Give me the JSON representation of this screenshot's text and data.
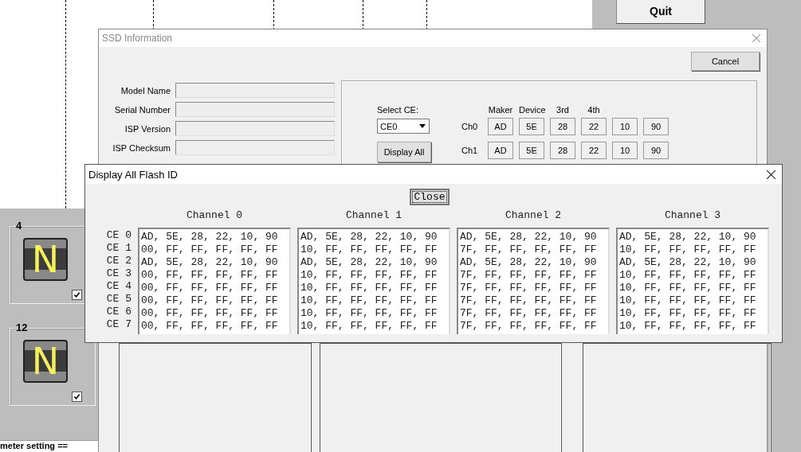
{
  "desktop": {
    "quit_button": "Quit",
    "slots": [
      {
        "label": "4",
        "icon_text": "N",
        "checked": true
      },
      {
        "label": "12",
        "icon_text": "N",
        "checked": true
      }
    ],
    "status_text": "meter setting =="
  },
  "ssd_window": {
    "title": "SSD Information",
    "cancel_button": "Cancel",
    "fields": [
      {
        "label": "Model Name"
      },
      {
        "label": "Serial Number"
      },
      {
        "label": "ISP Version"
      },
      {
        "label": "ISP Checksum"
      }
    ],
    "select_ce_label": "Select CE:",
    "ce_dropdown": "CE0",
    "display_all_button": "Display All",
    "id_headers": [
      "Maker",
      "Device",
      "3rd",
      "4th"
    ],
    "id_rows": [
      {
        "channel": "Ch0",
        "values": [
          "AD",
          "5E",
          "28",
          "22",
          "10",
          "90"
        ]
      },
      {
        "channel": "Ch1",
        "values": [
          "AD",
          "5E",
          "28",
          "22",
          "10",
          "90"
        ]
      }
    ]
  },
  "flash_window": {
    "title": "Display All Flash ID",
    "close_button": "Close",
    "ce_labels": [
      "CE 0",
      "CE 1",
      "CE 2",
      "CE 3",
      "CE 4",
      "CE 5",
      "CE 6",
      "CE 7"
    ],
    "channels": [
      {
        "title": "Channel 0",
        "lines": [
          "AD, 5E, 28, 22, 10, 90",
          "00, FF, FF, FF, FF, FF",
          "AD, 5E, 28, 22, 10, 90",
          "00, FF, FF, FF, FF, FF",
          "00, FF, FF, FF, FF, FF",
          "00, FF, FF, FF, FF, FF",
          "00, FF, FF, FF, FF, FF",
          "00, FF, FF, FF, FF, FF"
        ]
      },
      {
        "title": "Channel 1",
        "lines": [
          "AD, 5E, 28, 22, 10, 90",
          "10, FF, FF, FF, FF, FF",
          "AD, 5E, 28, 22, 10, 90",
          "10, FF, FF, FF, FF, FF",
          "10, FF, FF, FF, FF, FF",
          "10, FF, FF, FF, FF, FF",
          "10, FF, FF, FF, FF, FF",
          "10, FF, FF, FF, FF, FF"
        ]
      },
      {
        "title": "Channel 2",
        "lines": [
          "AD, 5E, 28, 22, 10, 90",
          "7F, FF, FF, FF, FF, FF",
          "AD, 5E, 28, 22, 10, 90",
          "7F, FF, FF, FF, FF, FF",
          "7F, FF, FF, FF, FF, FF",
          "7F, FF, FF, FF, FF, FF",
          "7F, FF, FF, FF, FF, FF",
          "7F, FF, FF, FF, FF, FF"
        ]
      },
      {
        "title": "Channel 3",
        "lines": [
          "AD, 5E, 28, 22, 10, 90",
          "10, FF, FF, FF, FF, FF",
          "AD, 5E, 28, 22, 10, 90",
          "10, FF, FF, FF, FF, FF",
          "10, FF, FF, FF, FF, FF",
          "10, FF, FF, FF, FF, FF",
          "10, FF, FF, FF, FF, FF",
          "10, FF, FF, FF, FF, FF"
        ]
      }
    ]
  }
}
